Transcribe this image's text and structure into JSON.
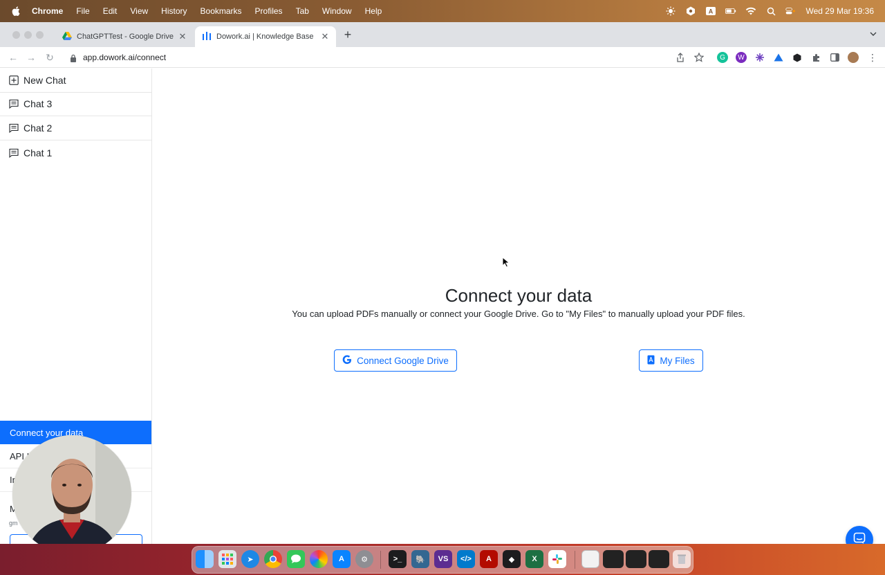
{
  "menubar": {
    "app_name": "Chrome",
    "items": [
      "File",
      "Edit",
      "View",
      "History",
      "Bookmarks",
      "Profiles",
      "Tab",
      "Window",
      "Help"
    ],
    "clock": "Wed 29 Mar  19:36"
  },
  "browser": {
    "tabs": [
      {
        "title": "ChatGPTTest - Google Drive",
        "icon": "google-drive-icon",
        "active": false
      },
      {
        "title": "Dowork.ai | Knowledge Base",
        "icon": "dowork-logo-icon",
        "active": true
      }
    ],
    "url": "app.dowork.ai/connect"
  },
  "sidebar": {
    "chats": [
      {
        "label": "New Chat",
        "icon": "plus-square-icon"
      },
      {
        "label": "Chat 3",
        "icon": "chat-icon"
      },
      {
        "label": "Chat 2",
        "icon": "chat-icon"
      },
      {
        "label": "Chat 1",
        "icon": "chat-icon"
      }
    ],
    "nav": [
      {
        "label": "Connect your data",
        "active": true
      },
      {
        "label": "API I",
        "active": false
      },
      {
        "label": "In",
        "active": false
      },
      {
        "label": "M",
        "active": false
      }
    ],
    "email_partial": "gm"
  },
  "main": {
    "title": "Connect your data",
    "description": "You can upload PDFs manually or connect your Google Drive. Go to \"My Files\" to manually upload your PDF files.",
    "connect_drive_label": "Connect Google Drive",
    "my_files_label": "My Files"
  },
  "colors": {
    "primary": "#0d6efd",
    "text": "#212529"
  }
}
